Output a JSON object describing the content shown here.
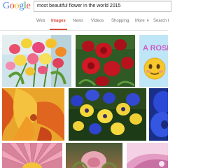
{
  "logo": {
    "letters": [
      "G",
      "o",
      "o",
      "g",
      "l",
      "e"
    ],
    "colors": [
      "#4285f4",
      "#ea4335",
      "#fbbc05",
      "#4285f4",
      "#34a853",
      "#ea4335"
    ]
  },
  "search": {
    "query": "most beautiful flower in the world 2015"
  },
  "tabs": {
    "web": "Web",
    "images": "Images",
    "news": "News",
    "videos": "Videos",
    "shopping": "Shopping",
    "more": "More",
    "search_tools": "Search t",
    "active": "images",
    "active_color": "#dd4b39"
  },
  "results": {
    "thumbnails": [
      {
        "name": "tulips-bouquet-image"
      },
      {
        "name": "red-roses-image"
      },
      {
        "name": "a-rose-smiley-image",
        "text": "A ROSE"
      },
      {
        "name": "orange-flower-closeup-image"
      },
      {
        "name": "blue-yellow-pansies-image"
      },
      {
        "name": "blue-flower-image"
      },
      {
        "name": "pink-daisy-image"
      },
      {
        "name": "rose-photo-image"
      },
      {
        "name": "pink-flower-image"
      }
    ]
  }
}
